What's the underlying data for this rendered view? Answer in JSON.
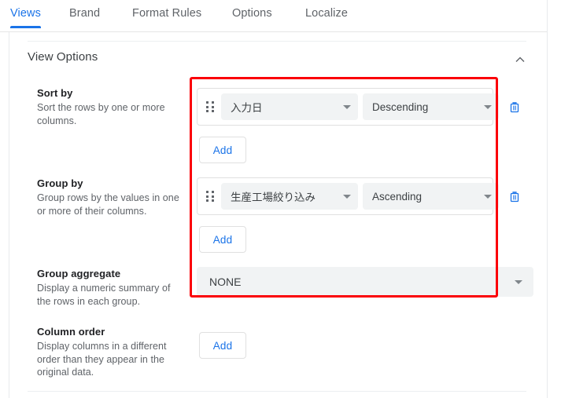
{
  "tabs": [
    {
      "label": "Views",
      "active": true
    },
    {
      "label": "Brand",
      "active": false
    },
    {
      "label": "Format Rules",
      "active": false
    },
    {
      "label": "Options",
      "active": false
    },
    {
      "label": "Localize",
      "active": false
    }
  ],
  "section": {
    "title": "View Options",
    "collapse_icon": "chevron-up-icon"
  },
  "sort_by": {
    "label": "Sort by",
    "description": "Sort the rows by one or more columns.",
    "rules": [
      {
        "drag_icon": "drag-handle-icon",
        "column": "入力日",
        "direction": "Descending",
        "delete_icon": "trash-icon"
      }
    ],
    "add_label": "Add"
  },
  "group_by": {
    "label": "Group by",
    "description": "Group rows by the values in one or more of their columns.",
    "rules": [
      {
        "drag_icon": "drag-handle-icon",
        "column": "生産工場絞り込み",
        "direction": "Ascending",
        "delete_icon": "trash-icon"
      }
    ],
    "add_label": "Add"
  },
  "group_aggregate": {
    "label": "Group aggregate",
    "description": "Display a numeric summary of the rows in each group.",
    "value": "NONE"
  },
  "column_order": {
    "label": "Column order",
    "description": "Display columns in a different order than they appear in the original data.",
    "add_label": "Add"
  },
  "annotation": {
    "color": "#fb0007",
    "shape": "rectangle"
  },
  "colors": {
    "accent": "#1a73e8",
    "text_primary": "#202124",
    "text_secondary": "#5f6368",
    "field_bg": "#f1f3f4",
    "border": "#e0e0e0"
  }
}
